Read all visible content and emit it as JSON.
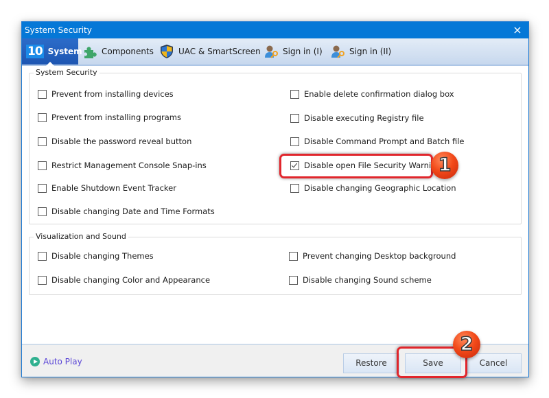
{
  "window": {
    "title": "System Security",
    "close_icon": "×"
  },
  "tabs": [
    {
      "label": "System",
      "icon": "windows-10-logo",
      "icon_text": "10",
      "active": true
    },
    {
      "label": "Components",
      "icon": "puzzle-piece",
      "active": false
    },
    {
      "label": "UAC & SmartScreen",
      "icon": "uac-shield",
      "active": false
    },
    {
      "label": "Sign in (I)",
      "icon": "user-key",
      "active": false
    },
    {
      "label": "Sign in (II)",
      "icon": "user-key",
      "active": false
    }
  ],
  "system_security": {
    "legend": "System Security",
    "left": [
      {
        "label": "Prevent from installing devices",
        "checked": false
      },
      {
        "label": "Prevent from installing programs",
        "checked": false
      },
      {
        "label": "Disable the password reveal button",
        "checked": false
      },
      {
        "label": "Restrict Management Console Snap-ins",
        "checked": false
      },
      {
        "label": "Enable Shutdown Event Tracker",
        "checked": false
      },
      {
        "label": "Disable changing Date and Time Formats",
        "checked": false
      }
    ],
    "right": [
      {
        "label": "Enable delete confirmation dialog box",
        "checked": false
      },
      {
        "label": "Disable executing Registry file",
        "checked": false
      },
      {
        "label": "Disable Command Prompt and Batch file",
        "checked": false
      },
      {
        "label": "Disable open File Security Warning",
        "checked": true
      },
      {
        "label": "Disable changing Geographic Location",
        "checked": false
      }
    ]
  },
  "visualization": {
    "legend": "Visualization and Sound",
    "left": [
      {
        "label": "Disable changing Themes",
        "checked": false
      },
      {
        "label": "Disable changing Color and Appearance",
        "checked": false
      }
    ],
    "right": [
      {
        "label": "Prevent changing Desktop background",
        "checked": false
      },
      {
        "label": "Disable changing Sound scheme",
        "checked": false
      }
    ]
  },
  "footer": {
    "auto_play": "Auto Play",
    "restore": "Restore",
    "save": "Save",
    "cancel": "Cancel"
  },
  "annotations": {
    "step1": "1",
    "step2": "2",
    "highlight_color": "#e1262c"
  }
}
